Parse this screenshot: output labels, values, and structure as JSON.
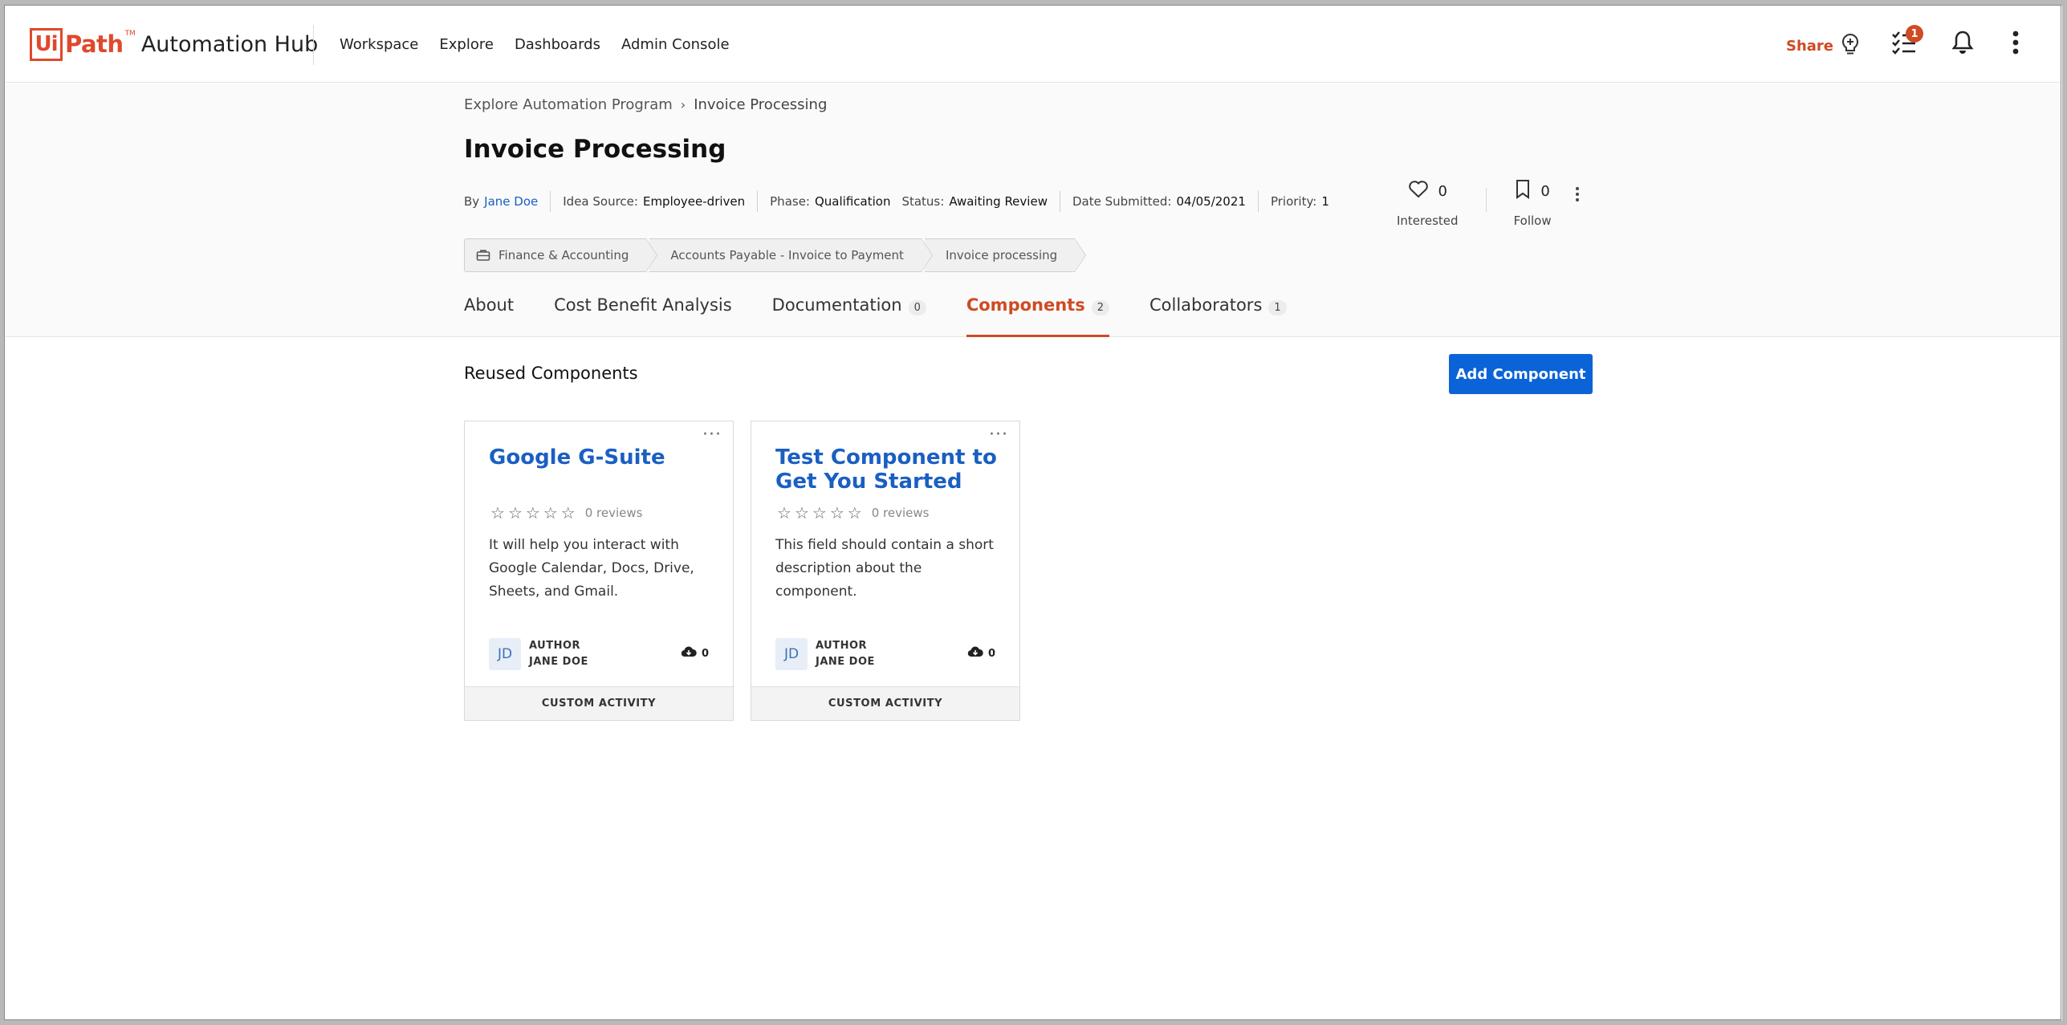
{
  "topbar": {
    "logo_ui": "Ui",
    "logo_path": "Path",
    "logo_tm": "TM",
    "product": "Automation Hub",
    "nav": [
      "Workspace",
      "Explore",
      "Dashboards",
      "Admin Console"
    ],
    "share_label": "Share",
    "tasks_badge": "1"
  },
  "breadcrumb": {
    "parent": "Explore Automation Program",
    "separator": "›",
    "current": "Invoice Processing"
  },
  "page_title": "Invoice Processing",
  "meta": {
    "by_label": "By",
    "by_value": "Jane Doe",
    "idea_source_label": "Idea Source:",
    "idea_source_value": "Employee-driven",
    "phase_label": "Phase:",
    "phase_value": "Qualification",
    "status_label": "Status:",
    "status_value": "Awaiting Review",
    "date_label": "Date Submitted:",
    "date_value": "04/05/2021",
    "priority_label": "Priority:",
    "priority_value": "1"
  },
  "reactions": {
    "interested_count": "0",
    "interested_label": "Interested",
    "follow_count": "0",
    "follow_label": "Follow"
  },
  "categories": [
    "Finance & Accounting",
    "Accounts Payable - Invoice to Payment",
    "Invoice processing"
  ],
  "tabs": [
    {
      "label": "About",
      "count": ""
    },
    {
      "label": "Cost Benefit Analysis",
      "count": ""
    },
    {
      "label": "Documentation",
      "count": "0"
    },
    {
      "label": "Components",
      "count": "2"
    },
    {
      "label": "Collaborators",
      "count": "1"
    }
  ],
  "section": {
    "title": "Reused Components",
    "add_button": "Add Component"
  },
  "cards": [
    {
      "title": "Google G-Suite",
      "reviews": "0 reviews",
      "description": "It will help you interact with Google Calendar, Docs, Drive, Sheets, and Gmail.",
      "avatar": "JD",
      "author_label": "AUTHOR",
      "author_name": "JANE DOE",
      "downloads": "0",
      "type": "CUSTOM ACTIVITY"
    },
    {
      "title": "Test Component to Get You Started",
      "reviews": "0 reviews",
      "description": "This field should contain a short description about the component.",
      "avatar": "JD",
      "author_label": "AUTHOR",
      "author_name": "JANE DOE",
      "downloads": "0",
      "type": "CUSTOM ACTIVITY"
    }
  ],
  "colors": {
    "brand": "#e0482c",
    "accent": "#d04a23",
    "link": "#1a5fc2",
    "primary_button": "#0b63d8"
  },
  "icons": {
    "share": "lightbulb-plus-icon",
    "tasks": "checklist-icon",
    "notifications": "bell-icon",
    "more": "kebab-icon",
    "interested": "heart-icon",
    "follow": "bookmark-icon",
    "category": "briefcase-icon",
    "downloads": "cloud-download-icon",
    "rating": "star-outline-icon"
  }
}
